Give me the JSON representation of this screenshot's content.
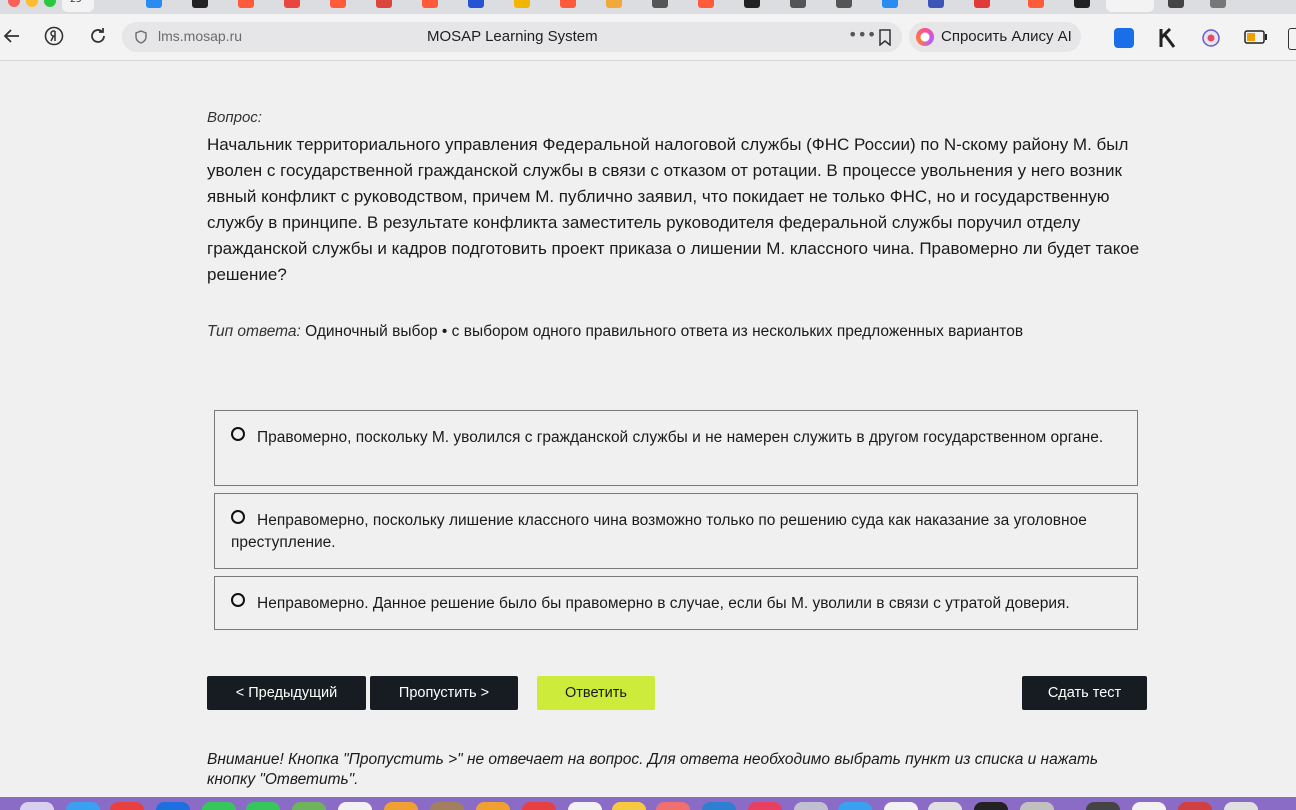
{
  "browser": {
    "url": "lms.mosap.ru",
    "page_title": "MOSAP Learning System",
    "alice_label": "Спросить Алису AI",
    "tab_badge": "23"
  },
  "question": {
    "label": "Вопрос:",
    "text": "Начальник территориального управления Федеральной налоговой службы (ФНС России) по N-скому району М. был уволен с государственной гражданской службы в связи с отказом от ротации. В процессе увольнения у него возник явный конфликт с руководством, причем М. публично заявил, что покидает не только ФНС, но и государственную службу в принципе. В результате конфликта заместитель руководителя федеральной службы поручил отделу гражданской службы и кадров подготовить проект приказа о лишении М. классного чина. Правомерно ли будет такое решение?",
    "answer_type_label": "Тип ответа:",
    "answer_type_value": "Одиночный выбор • с выбором одного правильного ответа из нескольких предложенных вариантов"
  },
  "options": [
    {
      "text": "Правомерно, поскольку М. уволился с гражданской службы и не намерен служить в другом государственном органе."
    },
    {
      "text": "Неправомерно, поскольку лишение классного чина возможно только по решению суда как наказание за уголовное преступление."
    },
    {
      "text": "Неправомерно. Данное решение было бы правомерно в случае, если бы М. уволили в связи с утратой доверия."
    }
  ],
  "buttons": {
    "prev": "< Предыдущий",
    "skip": "Пропустить >",
    "answer": "Ответить",
    "submit": "Сдать тест"
  },
  "warning": "Внимание! Кнопка \"Пропустить >\" не отвечает на вопрос. Для ответа необходимо выбрать пункт из списка и нажать кнопку \"Ответить\".",
  "colors": {
    "accent_lime": "#cdeb3a",
    "dark_button": "#161c22",
    "page_bg": "#f0f0f0"
  }
}
